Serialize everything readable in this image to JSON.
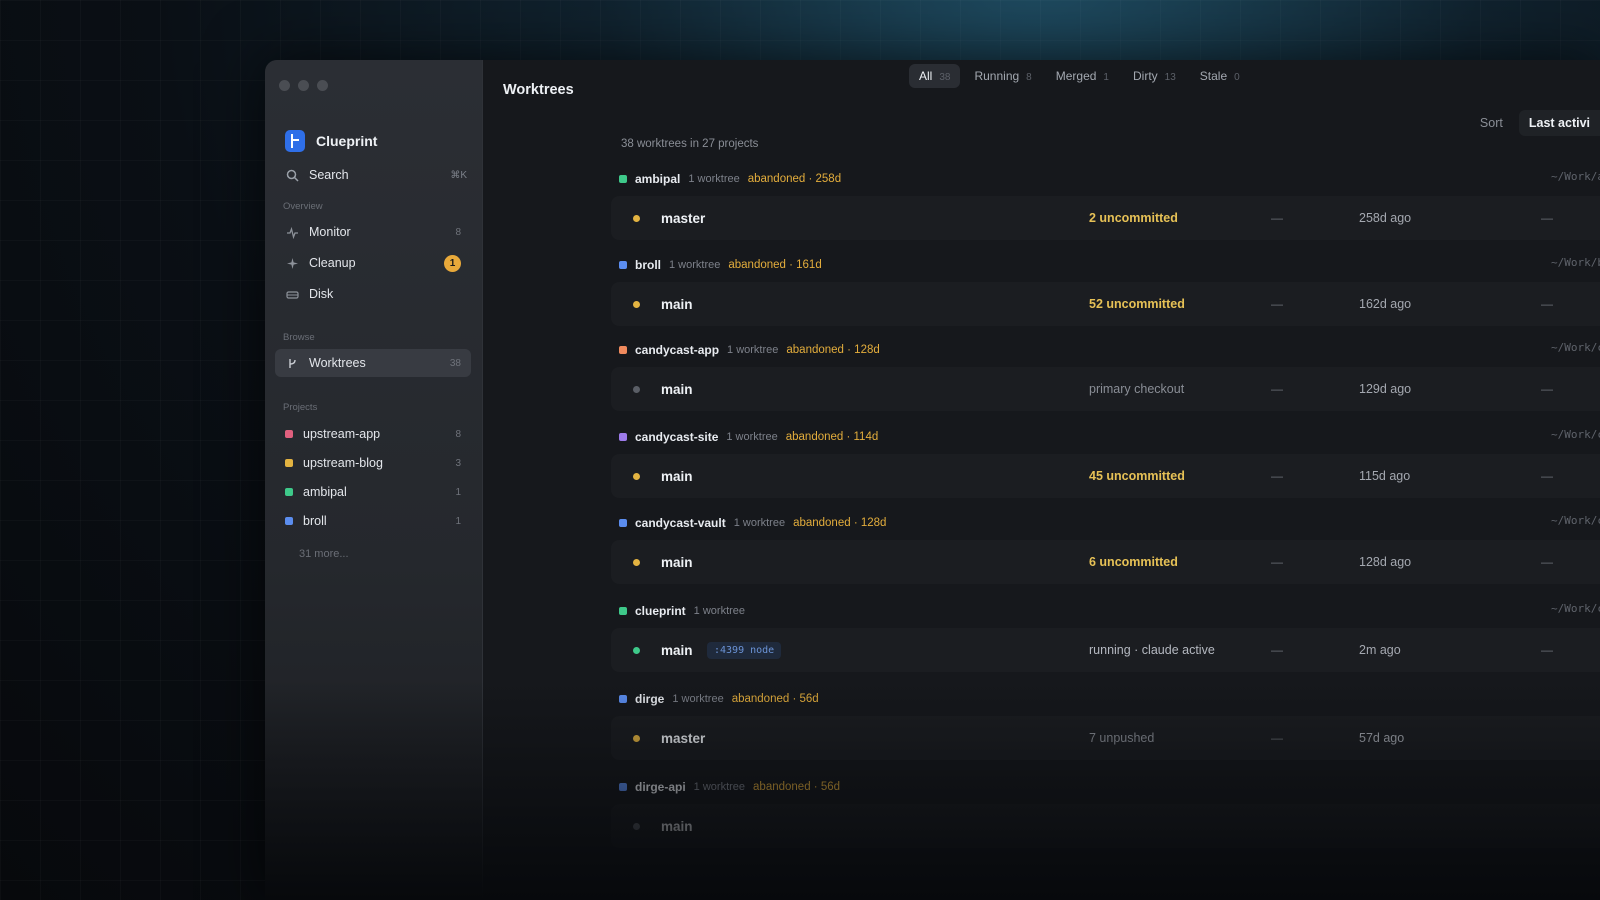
{
  "sidebar": {
    "brand": "Clueprint",
    "search": {
      "label": "Search",
      "shortcut": "⌘K"
    },
    "sections": {
      "overview": "Overview",
      "browse": "Browse",
      "projects": "Projects"
    },
    "overview_items": [
      {
        "label": "Monitor",
        "count": "8",
        "icon": "pulse-icon"
      },
      {
        "label": "Cleanup",
        "badge": "1",
        "icon": "sparkle-icon"
      },
      {
        "label": "Disk",
        "icon": "disk-icon"
      }
    ],
    "browse_items": [
      {
        "label": "Worktrees",
        "count": "38",
        "icon": "branch-icon"
      }
    ],
    "projects": [
      {
        "label": "upstream-app",
        "count": "8",
        "color": "#e0607e"
      },
      {
        "label": "upstream-blog",
        "count": "3",
        "color": "#e3b341"
      },
      {
        "label": "ambipal",
        "count": "1",
        "color": "#3ec98a"
      },
      {
        "label": "broll",
        "count": "1",
        "color": "#5b8def"
      }
    ],
    "more": "31 more..."
  },
  "main": {
    "title": "Worktrees",
    "filters": [
      {
        "label": "All",
        "count": "38"
      },
      {
        "label": "Running",
        "count": "8"
      },
      {
        "label": "Merged",
        "count": "1"
      },
      {
        "label": "Dirty",
        "count": "13"
      },
      {
        "label": "Stale",
        "count": "0"
      }
    ],
    "sort_label": "Sort",
    "sort_value": "Last activi",
    "summary": "38 worktrees in 27 projects",
    "groups": [
      {
        "name": "ambipal",
        "count": "1 worktree",
        "status": "abandoned · 258d",
        "path": "~/Work/ambip",
        "color": "#3ec98a",
        "branch": "master",
        "dot": "#e3b341",
        "state": "2 uncommitted",
        "dash": "—",
        "time": "258d ago",
        "dash2": "—"
      },
      {
        "name": "broll",
        "count": "1 worktree",
        "status": "abandoned · 161d",
        "path": "~/Work/bro",
        "color": "#5b8def",
        "branch": "main",
        "dot": "#e3b341",
        "state": "52 uncommitted",
        "dash": "—",
        "time": "162d ago",
        "dash2": "—"
      },
      {
        "name": "candycast-app",
        "count": "1 worktree",
        "status": "abandoned · 128d",
        "path": "~/Work/candycast/candycast-",
        "color": "#f08a5d",
        "branch": "main",
        "dot": "#5a5e66",
        "state": "primary checkout",
        "dash": "—",
        "time": "129d ago",
        "dash2": "—"
      },
      {
        "name": "candycast-site",
        "count": "1 worktree",
        "status": "abandoned · 114d",
        "path": "~/Work/candycast/candycast-s",
        "color": "#9d7bea",
        "branch": "main",
        "dot": "#e3b341",
        "state": "45 uncommitted",
        "dash": "—",
        "time": "115d ago",
        "dash2": "—"
      },
      {
        "name": "candycast-vault",
        "count": "1 worktree",
        "status": "abandoned · 128d",
        "path": "~/Work/candycast/candycast-va",
        "color": "#5b8def",
        "branch": "main",
        "dot": "#e3b341",
        "state": "6 uncommitted",
        "dash": "—",
        "time": "128d ago",
        "dash2": "—"
      },
      {
        "name": "clueprint",
        "count": "1 worktree",
        "status": "",
        "path": "~/Work/cluep",
        "color": "#3ec98a",
        "branch": "main",
        "dot": "#3ec98a",
        "port": ":4399  node",
        "state": "running · claude active",
        "dash": "—",
        "time": "2m ago",
        "dash2": "—"
      },
      {
        "name": "dirge",
        "count": "1 worktree",
        "status": "abandoned · 56d",
        "path": "",
        "color": "#5b8def",
        "branch": "master",
        "dot": "#e3b341",
        "state": "7 unpushed",
        "dash": "—",
        "time": "57d ago",
        "dash2": ""
      },
      {
        "name": "dirge-api",
        "count": "1 worktree",
        "status": "abandoned · 56d",
        "path": "",
        "color": "#5b8def",
        "branch": "main",
        "dot": "#5a5e66",
        "state": "",
        "dash": "",
        "time": "",
        "dash2": ""
      }
    ]
  }
}
